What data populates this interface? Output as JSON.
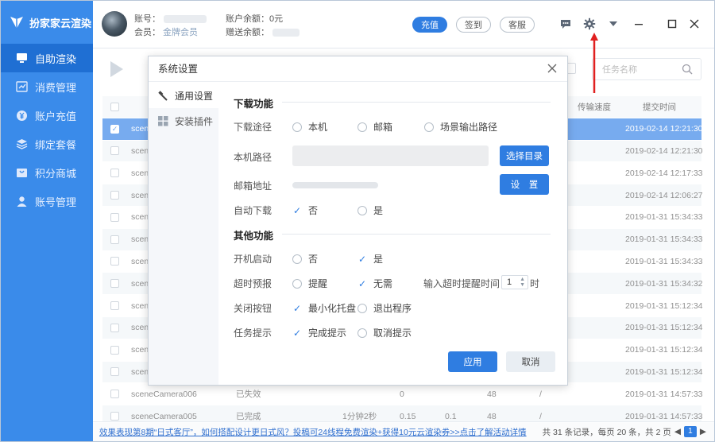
{
  "app": {
    "name": "扮家家云渲染"
  },
  "sidebar": {
    "items": [
      {
        "label": "自助渲染",
        "icon": "display-icon",
        "active": true
      },
      {
        "label": "消费管理",
        "icon": "chart-icon",
        "active": false
      },
      {
        "label": "账户充值",
        "icon": "yen-icon",
        "active": false
      },
      {
        "label": "绑定套餐",
        "icon": "package-icon",
        "active": false
      },
      {
        "label": "积分商城",
        "icon": "shop-icon",
        "active": false
      },
      {
        "label": "账号管理",
        "icon": "user-icon",
        "active": false
      }
    ]
  },
  "header": {
    "account_label": "账号：",
    "member_label": "会员：",
    "member_value": "金牌会员",
    "balance_label": "账户余额：",
    "balance_value": "0元",
    "gift_balance_label": "赠送余额：",
    "recharge_button": "充值",
    "signin_button": "签到",
    "service_button": "客服",
    "accent_color": "#2f7de1"
  },
  "toolbar": {
    "search_placeholder": "任务名称"
  },
  "table": {
    "columns": [
      "传输速度",
      "提交时间"
    ],
    "rows": [
      {
        "name": "scene",
        "status": "",
        "time": "2019-02-14 12:21:30",
        "selected": true
      },
      {
        "name": "scene",
        "status": "",
        "time": "2019-02-14 12:21:30"
      },
      {
        "name": "scene",
        "status": "",
        "time": "2019-02-14 12:17:33"
      },
      {
        "name": "scene",
        "status": "",
        "time": "2019-02-14 12:06:27"
      },
      {
        "name": "scene",
        "status": "",
        "time": "2019-01-31 15:34:33"
      },
      {
        "name": "scene",
        "status": "",
        "time": "2019-01-31 15:34:33"
      },
      {
        "name": "scene",
        "status": "",
        "time": "2019-01-31 15:34:33"
      },
      {
        "name": "scene",
        "status": "",
        "time": "2019-01-31 15:34:32"
      },
      {
        "name": "scene",
        "status": "",
        "time": "2019-01-31 15:12:34"
      },
      {
        "name": "scene",
        "status": "",
        "time": "2019-01-31 15:12:34"
      },
      {
        "name": "scene",
        "status": "",
        "time": "2019-01-31 15:12:34"
      },
      {
        "name": "scene",
        "status": "",
        "time": "2019-01-31 15:12:34"
      },
      {
        "name": "sceneCamera006",
        "status": "已失效",
        "duration": "",
        "c1": "0",
        "c2": "",
        "c3": "48",
        "c4": "/",
        "time": "2019-01-31 14:57:33"
      },
      {
        "name": "sceneCamera005",
        "status": "已完成",
        "duration": "1分钟2秒",
        "c1": "0.15",
        "c2": "0.1",
        "c3": "48",
        "c4": "/",
        "time": "2019-01-31 14:57:33"
      }
    ]
  },
  "statusbar": {
    "marquee": "效果表现第8期“日式客厅”，如何搭配设计更日式风？投稿可24线程免费渲染+获得10元云渲染券>>点击了解活动详情",
    "summary": "共 31 条记录，每页 20 条，共 2 页",
    "current_page": "1"
  },
  "dialog": {
    "title": "系统设置",
    "tabs": [
      {
        "label": "通用设置",
        "icon": "wrench-icon"
      },
      {
        "label": "安装插件",
        "icon": "grid-icon"
      }
    ],
    "download_section": "下载功能",
    "download_path_label": "下载途径",
    "download_options": [
      "本机",
      "邮箱",
      "场景输出路径"
    ],
    "local_path_label": "本机路径",
    "choose_dir_button": "选择目录",
    "email_label": "邮箱地址",
    "set_button": "设　置",
    "auto_download_label": "自动下载",
    "auto_download_options": [
      "否",
      "是"
    ],
    "other_section": "其他功能",
    "startup_label": "开机启动",
    "startup_options": [
      "否",
      "是"
    ],
    "timeout_label": "超时预报",
    "timeout_options": [
      "提醒",
      "无需"
    ],
    "timeout_input_label": "输入超时提醒时间：",
    "timeout_value": "1",
    "timeout_unit": "时",
    "close_button_label": "关闭按钮",
    "close_options": [
      "最小化托盘",
      "退出程序"
    ],
    "task_hint_label": "任务提示",
    "task_hint_options": [
      "完成提示",
      "取消提示"
    ],
    "apply_button": "应用",
    "cancel_button": "取消"
  }
}
